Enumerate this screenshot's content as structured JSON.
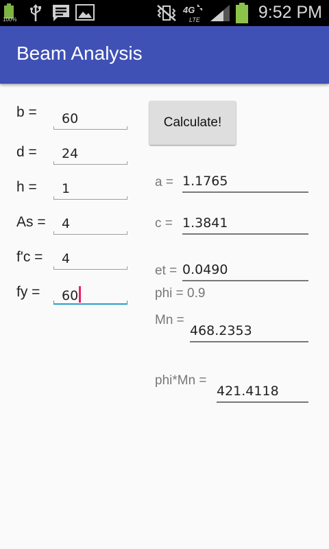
{
  "status_bar": {
    "battery_percent": "100%",
    "network": "4G LTE",
    "time": "9:52 PM"
  },
  "app_bar": {
    "title": "Beam Analysis"
  },
  "inputs": [
    {
      "label": "b =",
      "value": "60"
    },
    {
      "label": "d =",
      "value": "24"
    },
    {
      "label": "h =",
      "value": "1"
    },
    {
      "label": "As =",
      "value": "4"
    },
    {
      "label": "f'c =",
      "value": "4"
    },
    {
      "label": "fy =",
      "value": "60"
    }
  ],
  "calculate_button": {
    "label": "Calculate!"
  },
  "results": {
    "a": {
      "label": "a =",
      "value": "1.1765"
    },
    "c": {
      "label": "c =",
      "value": "1.3841"
    },
    "et": {
      "label": "et =",
      "value": "0.0490"
    },
    "phi": {
      "text": "phi = 0.9"
    },
    "mn": {
      "label": "Mn =",
      "value": "468.2353"
    },
    "phimn": {
      "label": "phi*Mn =",
      "value": "421.4118"
    }
  },
  "colors": {
    "app_bar": "#3f51b5",
    "focus_underline": "#26a0c8",
    "cursor": "#e91e63",
    "battery": "#8bc34a"
  }
}
